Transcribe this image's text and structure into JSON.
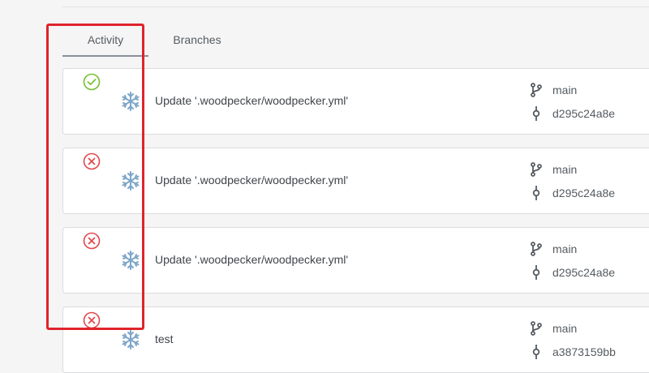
{
  "tabs": [
    {
      "label": "Activity",
      "active": true
    },
    {
      "label": "Branches",
      "active": false
    }
  ],
  "colors": {
    "success": "#72c02c",
    "failure": "#e0474c",
    "highlight": "#e0232b",
    "avatar": "#7ea6c9"
  },
  "pipelines": [
    {
      "status": "success",
      "status_icon": "check-circle-icon",
      "avatar_icon": "snowflake-icon",
      "message": "Update '.woodpecker/woodpecker.yml'",
      "branch": "main",
      "commit": "d295c24a8e"
    },
    {
      "status": "failure",
      "status_icon": "x-circle-icon",
      "avatar_icon": "snowflake-icon",
      "message": "Update '.woodpecker/woodpecker.yml'",
      "branch": "main",
      "commit": "d295c24a8e"
    },
    {
      "status": "failure",
      "status_icon": "x-circle-icon",
      "avatar_icon": "snowflake-icon",
      "message": "Update '.woodpecker/woodpecker.yml'",
      "branch": "main",
      "commit": "d295c24a8e"
    },
    {
      "status": "failure",
      "status_icon": "x-circle-icon",
      "avatar_icon": "snowflake-icon",
      "message": "test",
      "branch": "main",
      "commit": "a3873159bb"
    }
  ]
}
